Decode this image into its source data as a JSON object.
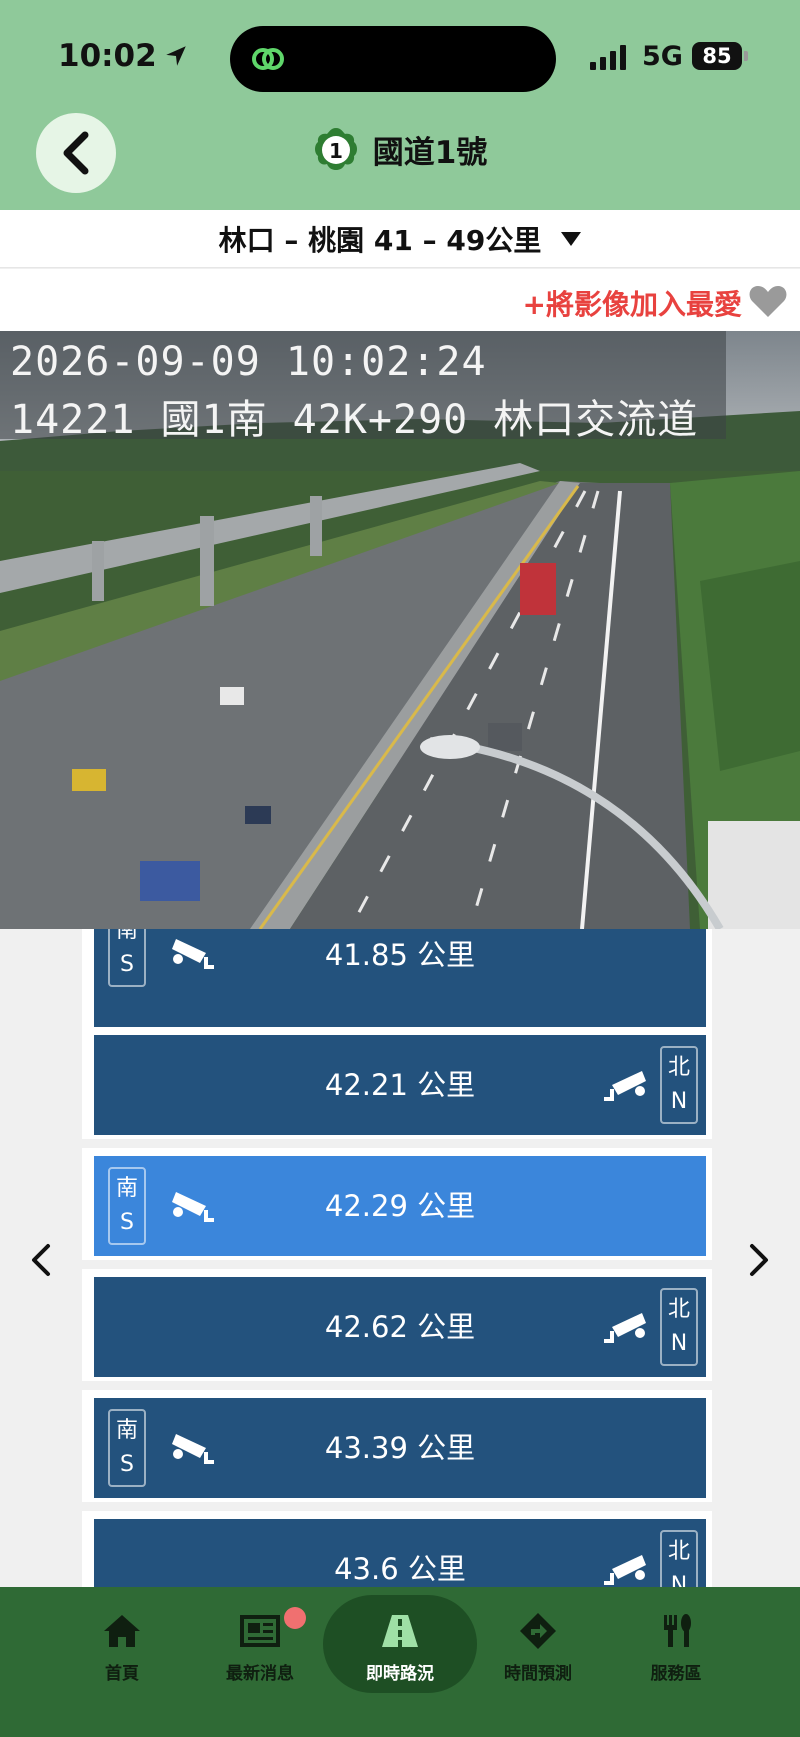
{
  "status_bar": {
    "time": "10:02",
    "network": "5G",
    "battery": "85"
  },
  "header": {
    "title": "國道1號",
    "route_number": "1"
  },
  "section": {
    "label": "林口 – 桃園 41 – 49公里"
  },
  "favorite": {
    "label": "+將影像加入最愛"
  },
  "camera": {
    "timestamp": "2026-09-09 10:02:24",
    "location": "14221 國1南 42K+290 林口交流道"
  },
  "camera_list": [
    {
      "direction": "south",
      "dir_zh": "南",
      "dir_en": "S",
      "km": "41.85 公里",
      "active": false
    },
    {
      "direction": "north",
      "dir_zh": "北",
      "dir_en": "N",
      "km": "42.21 公里",
      "active": false
    },
    {
      "direction": "south",
      "dir_zh": "南",
      "dir_en": "S",
      "km": "42.29 公里",
      "active": true
    },
    {
      "direction": "north",
      "dir_zh": "北",
      "dir_en": "N",
      "km": "42.62 公里",
      "active": false
    },
    {
      "direction": "south",
      "dir_zh": "南",
      "dir_en": "S",
      "km": "43.39 公里",
      "active": false
    },
    {
      "direction": "north",
      "dir_zh": "北",
      "dir_en": "N",
      "km": "43.6 公里",
      "active": false
    }
  ],
  "tabs": [
    {
      "label": "首頁",
      "icon": "home-icon"
    },
    {
      "label": "最新消息",
      "icon": "news-icon",
      "badge": true
    },
    {
      "label": "即時路況",
      "icon": "road-icon",
      "active": true
    },
    {
      "label": "時間預測",
      "icon": "route-sign-icon"
    },
    {
      "label": "服務區",
      "icon": "utensils-icon"
    }
  ],
  "colors": {
    "header_green": "#8fc99a",
    "tabbar_green": "#2f6a35",
    "row_blue": "#23527d",
    "row_active": "#3b86db",
    "accent_red": "#e8423f"
  }
}
